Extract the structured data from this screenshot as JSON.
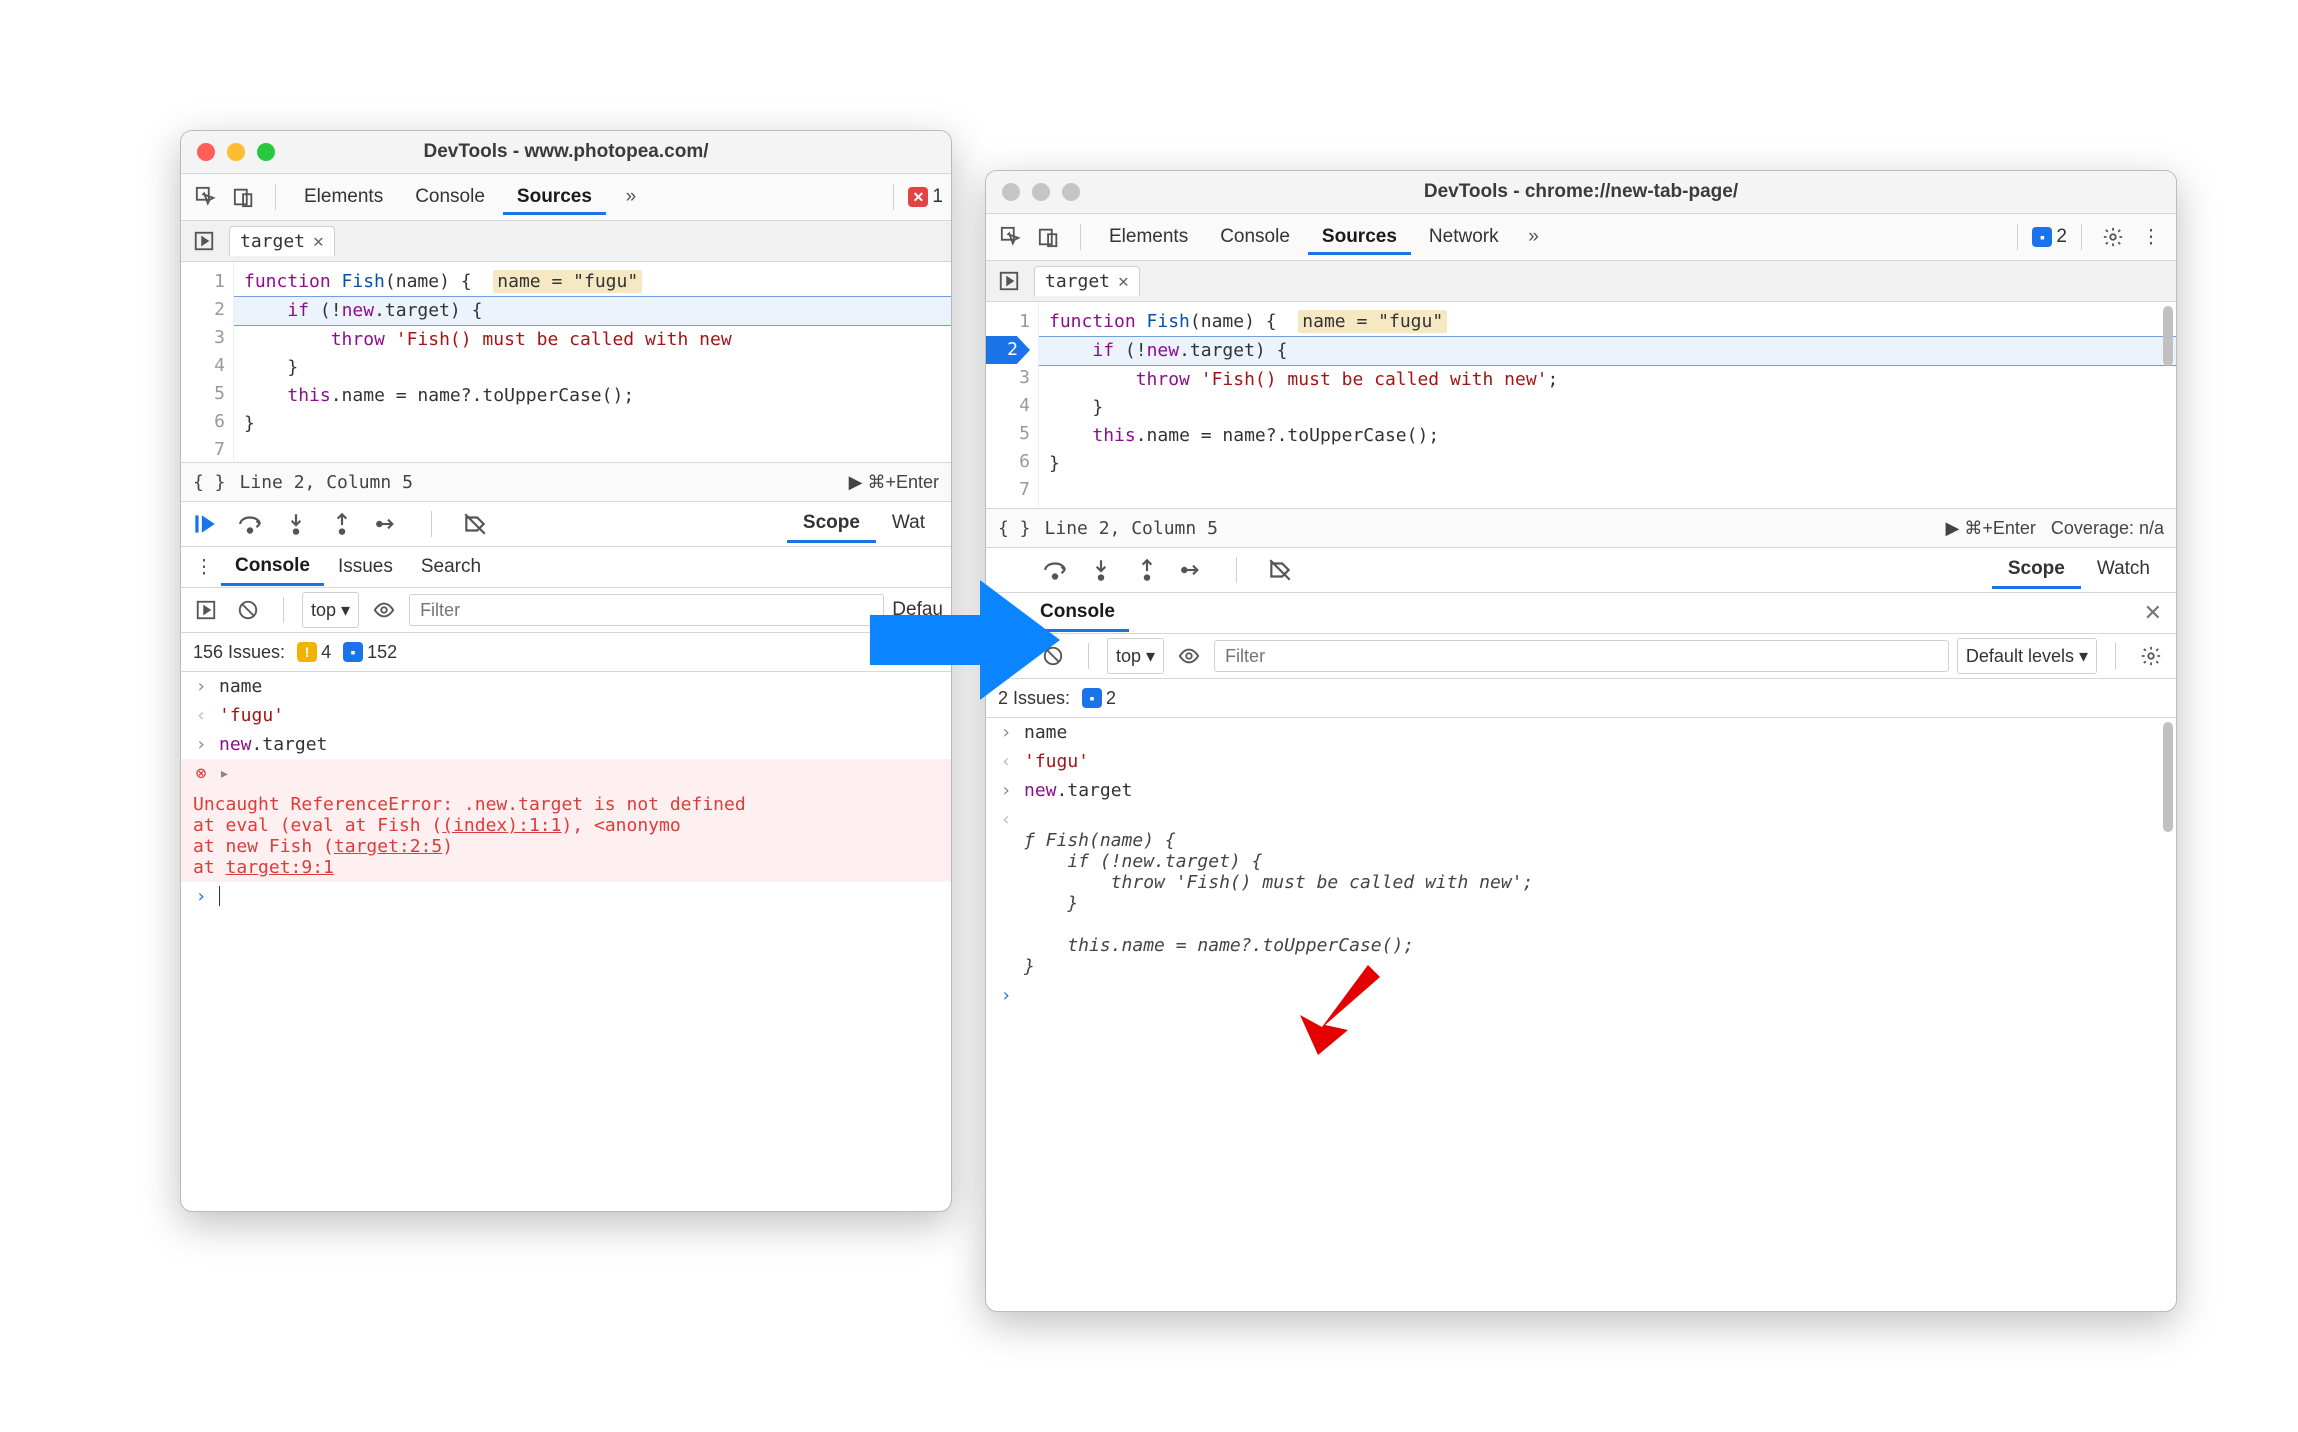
{
  "left": {
    "title": "DevTools - www.photopea.com/",
    "tabs": {
      "elements": "Elements",
      "console": "Console",
      "sources": "Sources"
    },
    "errorCount": "1",
    "filetab": "target",
    "code": {
      "lines": [
        "1",
        "2",
        "3",
        "4",
        "5",
        "6",
        "7"
      ],
      "l1_1": "function",
      "l1_2": " Fish",
      "l1_3": "(name) {",
      "l1_pill": "name = \"fugu\"",
      "l2_1": "    ",
      "l2_2": "if",
      "l2_3": " (!",
      "l2_4": "new",
      "l2_5": ".target) {",
      "l3_1": "        ",
      "l3_2": "throw",
      "l3_3": " ",
      "l3_4": "'Fish() must be called with new",
      "l4": "    }",
      "l5": "",
      "l6_1": "    ",
      "l6_2": "this",
      "l6_3": ".name = name?.toUpperCase();",
      "l7": "}"
    },
    "cursor": "Line 2, Column 5",
    "run": "▶ ⌘+Enter",
    "scope": "Scope",
    "watch": "Wat",
    "drawer": {
      "console": "Console",
      "issues": "Issues",
      "search": "Search"
    },
    "consoleBar": {
      "top": "top ▾",
      "filter": "Filter",
      "levels": "Defau"
    },
    "issues": {
      "label": "156 Issues:",
      "warn": "4",
      "msg": "152"
    },
    "con": {
      "l1": "name",
      "l2": "'fugu'",
      "l3": "new",
      "l3b": ".target",
      "err_main": "Uncaught ReferenceError: .new.target is not defined",
      "err_s1a": "    at eval (eval at Fish (",
      "err_s1b": "(index):1:1",
      "err_s1c": "), <anonymo",
      "err_s2a": "    at new Fish (",
      "err_s2b": "target:2:5",
      "err_s2c": ")",
      "err_s3a": "    at ",
      "err_s3b": "target:9:1"
    }
  },
  "right": {
    "title": "DevTools - chrome://new-tab-page/",
    "tabs": {
      "elements": "Elements",
      "console": "Console",
      "sources": "Sources",
      "network": "Network"
    },
    "msgCount": "2",
    "filetab": "target",
    "code": {
      "lines": [
        "1",
        "2",
        "3",
        "4",
        "5",
        "6",
        "7"
      ],
      "l1_1": "function",
      "l1_2": " Fish",
      "l1_3": "(name) {",
      "l1_pill": "name = \"fugu\"",
      "l2_1": "    ",
      "l2_2": "if",
      "l2_3": " (!",
      "l2_4": "new",
      "l2_5": ".target) {",
      "l3_1": "        ",
      "l3_2": "throw",
      "l3_3": " ",
      "l3_4": "'Fish() must be called with new'",
      "l3_5": ";",
      "l4": "    }",
      "l5": "",
      "l6_1": "    ",
      "l6_2": "this",
      "l6_3": ".name = name?.toUpperCase();",
      "l7": "}"
    },
    "cursor": "Line 2, Column 5",
    "run": "▶ ⌘+Enter",
    "coverage": "Coverage: n/a",
    "scope": "Scope",
    "watch": "Watch",
    "drawer": {
      "console": "Console"
    },
    "consoleBar": {
      "top": "top ▾",
      "filter": "Filter",
      "levels": "Default levels ▾"
    },
    "issues": {
      "label": "2 Issues:",
      "msg": "2"
    },
    "con": {
      "l1": "name",
      "l2": "'fugu'",
      "l3": "new",
      "l3b": ".target",
      "r1": "ƒ Fish(name) {",
      "r2": "    if (!new.target) {",
      "r3": "        throw 'Fish() must be called with new';",
      "r4": "    }",
      "r5": "",
      "r6": "    this.name = name?.toUpperCase();",
      "r7": "}"
    }
  }
}
